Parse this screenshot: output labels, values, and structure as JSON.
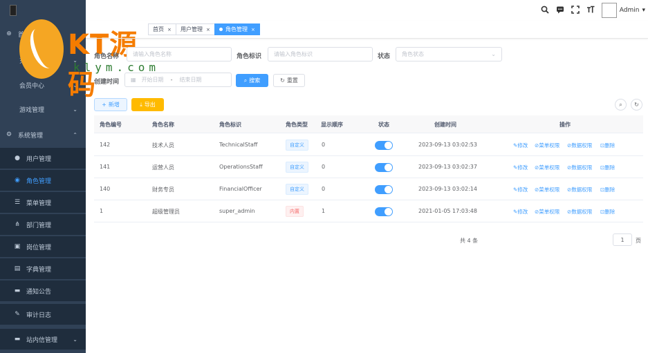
{
  "sidebar": {
    "items": [
      {
        "label": "首页",
        "icon": "dashboard-icon",
        "glyph": "⊕"
      },
      {
        "label": "充值中心",
        "icon": "folder-icon",
        "glyph": ""
      },
      {
        "label": "会员中心",
        "icon": "folder-icon",
        "glyph": ""
      },
      {
        "label": "游戏管理",
        "icon": "folder-icon",
        "glyph": ""
      },
      {
        "label": "系统管理",
        "icon": "gear-icon",
        "glyph": "⚙"
      },
      {
        "label": "用户管理",
        "icon": "user-icon",
        "glyph": "●"
      },
      {
        "label": "角色管理",
        "icon": "people-icon",
        "glyph": "◉"
      },
      {
        "label": "菜单管理",
        "icon": "list-icon",
        "glyph": "☰"
      },
      {
        "label": "部门管理",
        "icon": "tree-icon",
        "glyph": "⋔"
      },
      {
        "label": "岗位管理",
        "icon": "post-icon",
        "glyph": "▣"
      },
      {
        "label": "字典管理",
        "icon": "dict-icon",
        "glyph": "▤"
      },
      {
        "label": "通知公告",
        "icon": "message-icon",
        "glyph": "▬"
      },
      {
        "label": "审计日志",
        "icon": "log-icon",
        "glyph": "✎"
      },
      {
        "label": "站内信管理",
        "icon": "mail-icon",
        "glyph": "▬"
      }
    ]
  },
  "watermark": {
    "text": "KT源码",
    "sub": "klym.com"
  },
  "navbar": {
    "username": "Admin",
    "dropdown": "▾"
  },
  "tags": [
    {
      "label": "首页"
    },
    {
      "label": "用户管理"
    },
    {
      "label": "角色管理"
    }
  ],
  "search": {
    "role_name_label": "角色名称",
    "role_name_placeholder": "请输入角色名称",
    "role_key_label": "角色标识",
    "role_key_placeholder": "请输入角色标识",
    "status_label": "状态",
    "status_placeholder": "角色状态",
    "created_label": "创建时间",
    "start_placeholder": "开始日期",
    "range_sep": "-",
    "end_placeholder": "结束日期",
    "search_btn": "搜索",
    "reset_btn": "重置"
  },
  "toolbar": {
    "add_btn": "新增",
    "export_btn": "导出"
  },
  "table": {
    "headers": [
      "角色编号",
      "角色名称",
      "角色标识",
      "角色类型",
      "显示顺序",
      "状态",
      "创建时间",
      "操作"
    ],
    "rows": [
      {
        "id": "142",
        "name": "技术人员",
        "key": "TechnicalStaff",
        "type": "自定义",
        "type_kind": "info",
        "order": "0",
        "status_on": true,
        "created": "2023-09-13 03:02:53"
      },
      {
        "id": "141",
        "name": "运营人员",
        "key": "OperationsStaff",
        "type": "自定义",
        "type_kind": "info",
        "order": "0",
        "status_on": true,
        "created": "2023-09-13 03:02:37"
      },
      {
        "id": "140",
        "name": "财务专员",
        "key": "FinancialOfficer",
        "type": "自定义",
        "type_kind": "info",
        "order": "0",
        "status_on": true,
        "created": "2023-09-13 03:02:14"
      },
      {
        "id": "1",
        "name": "超级管理员",
        "key": "super_admin",
        "type": "内置",
        "type_kind": "danger",
        "order": "1",
        "status_on": true,
        "created": "2021-01-05 17:03:48"
      }
    ],
    "ops": [
      "修改",
      "菜单权限",
      "数据权限",
      "删除"
    ]
  },
  "pager": {
    "total": "共 4 条",
    "page": "1",
    "unit": "页"
  },
  "colors": {
    "sidebar_bg": "#304156",
    "primary": "#409eff",
    "warning": "#ffba00",
    "danger": "#f56c6c"
  }
}
